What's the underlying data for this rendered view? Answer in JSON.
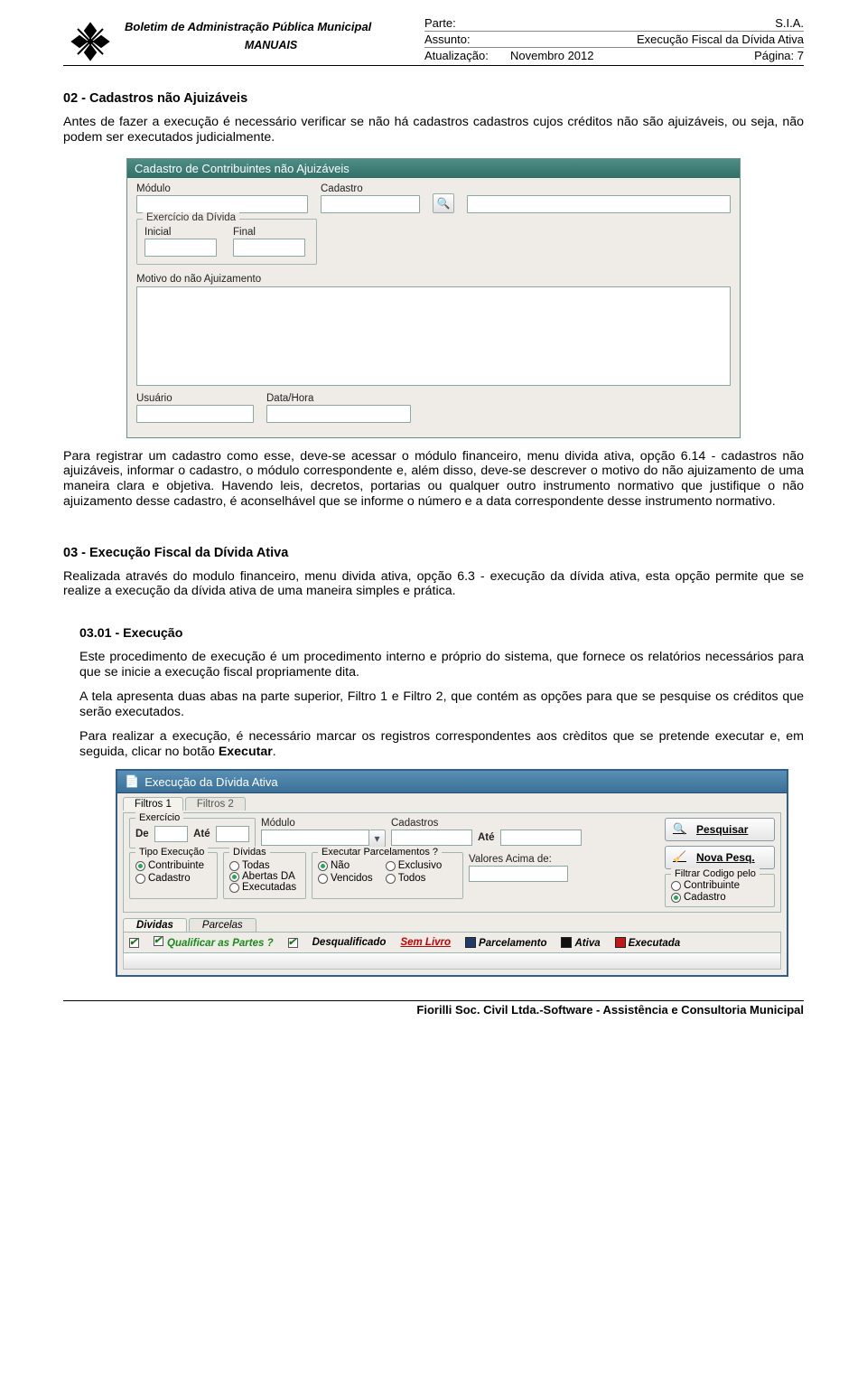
{
  "header": {
    "title_line1": "Boletim de Administração Pública Municipal",
    "title_line2": "MANUAIS",
    "labels": {
      "parte": "Parte:",
      "assunto": "Assunto:",
      "atualizacao": "Atualização:"
    },
    "parte_val": "S.I.A.",
    "assunto_val": "Execução Fiscal da Dívida Ativa",
    "atual_left": "Novembro 2012",
    "atual_right": "Página: 7"
  },
  "section02": {
    "title": "02 - Cadastros não Ajuizáveis",
    "para1": "Antes de fazer a execução é necessário verificar se não há cadastros cadastros cujos créditos não são ajuizáveis, ou seja, não podem ser executados judicialmente.",
    "para2": "Para registrar um cadastro como esse, deve-se acessar o módulo financeiro, menu divida ativa, opção 6.14 - cadastros não ajuizáveis, informar o cadastro, o módulo correspondente e, além disso, deve-se descrever o motivo do não ajuizamento de uma maneira clara e objetiva. Havendo leis, decretos, portarias ou qualquer outro instrumento normativo que justifique o não ajuizamento desse cadastro, é aconselhável que se informe o número e a data correspondente desse instrumento normativo."
  },
  "app1": {
    "title": "Cadastro de Contribuintes não Ajuizáveis",
    "modulo": "Módulo",
    "cadastro": "Cadastro",
    "group_exercicio": "Exercício da Dívida",
    "inicial": "Inicial",
    "final": "Final",
    "motivo": "Motivo do não Ajuizamento",
    "usuario": "Usuário",
    "datahora": "Data/Hora"
  },
  "section03": {
    "title": "03 - Execução Fiscal da Dívida Ativa",
    "para": "Realizada através do modulo financeiro, menu divida ativa, opção 6.3 - execução da dívida ativa, esta opção permite que se realize a execução da dívida ativa de uma maneira simples e prática."
  },
  "section0301": {
    "title": "03.01 - Execução",
    "p1": "Este procedimento de execução é um procedimento interno e próprio do sistema, que fornece os relatórios necessários para que se inicie a execução fiscal propriamente dita.",
    "p2": "A tela apresenta duas abas na parte superior, Filtro 1 e Filtro 2, que contém as opções para que se pesquise os créditos que serão executados.",
    "p3_a": "Para realizar a execução, é necessário marcar os registros correspondentes aos crèditos que se pretende executar e, em seguida, clicar no botão ",
    "p3_b": "Executar",
    "p3_c": "."
  },
  "app2": {
    "title": "Execução da Dívida Ativa",
    "tab1": "Filtros 1",
    "tab2": "Filtros 2",
    "exercicio": "Exercício",
    "de": "De",
    "ate": "Até",
    "modulo": "Módulo",
    "cadastros": "Cadastros",
    "ate2": "Até",
    "tipo_exec": "Tipo Execução",
    "te_contrib": "Contribuinte",
    "te_cadastro": "Cadastro",
    "dividas": "Dívidas",
    "dv_todas": "Todas",
    "dv_abertas": "Abertas DA",
    "dv_exec": "Executadas",
    "exec_parc": "Executar Parcelamentos ?",
    "ep_nao": "Não",
    "ep_excl": "Exclusivo",
    "ep_venc": "Vencidos",
    "ep_todos": "Todos",
    "valores_acima": "Valores Acima de:",
    "btn_pesq": "Pesquisar",
    "btn_nova": "Nova Pesq.",
    "filtrar_grp": "Filtrar Codigo pelo",
    "fc_contrib": "Contribuinte",
    "fc_cadastro": "Cadastro",
    "tab_div": "Dividas",
    "tab_parc": "Parcelas",
    "qualificar": "Qualificar as Partes ?",
    "leg_desq": "Desqualificado",
    "leg_semlivro": "Sem Livro",
    "leg_parc": "Parcelamento",
    "leg_ativa": "Ativa",
    "leg_exec": "Executada"
  },
  "footer": "Fiorilli Soc. Civil Ltda.-Software - Assistência e Consultoria Municipal"
}
